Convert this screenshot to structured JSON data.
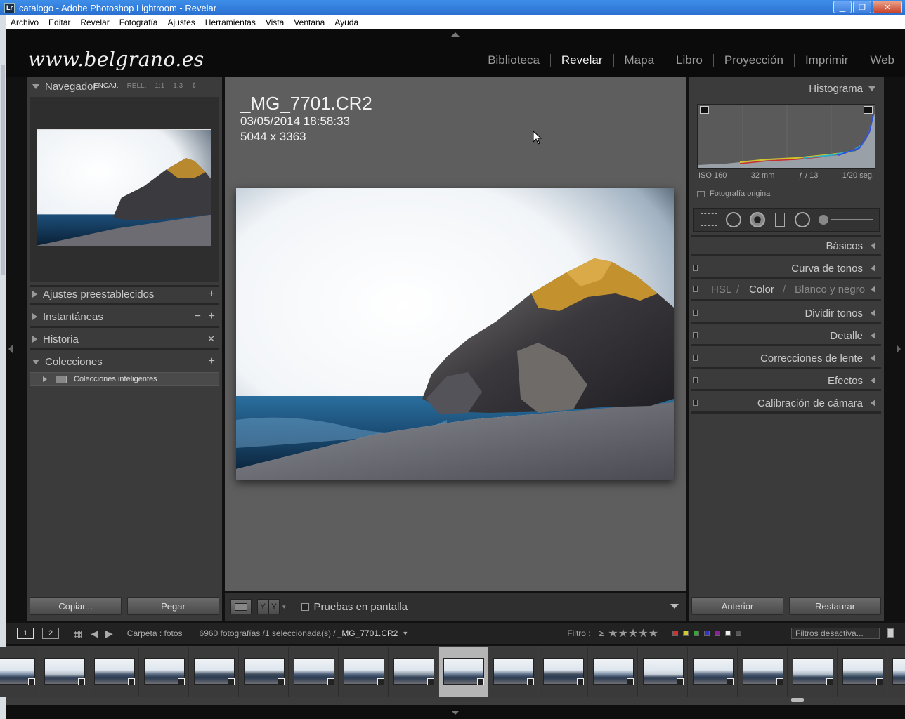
{
  "window": {
    "title": "catalogo - Adobe Photoshop Lightroom - Revelar",
    "app_icon_text": "Lr"
  },
  "menu": [
    "Archivo",
    "Editar",
    "Revelar",
    "Fotografía",
    "Ajustes",
    "Herramientas",
    "Vista",
    "Ventana",
    "Ayuda"
  ],
  "identity_plate": "www.belgrano.es",
  "modules": [
    {
      "label": "Biblioteca",
      "active": false
    },
    {
      "label": "Revelar",
      "active": true
    },
    {
      "label": "Mapa",
      "active": false
    },
    {
      "label": "Libro",
      "active": false
    },
    {
      "label": "Proyección",
      "active": false
    },
    {
      "label": "Imprimir",
      "active": false
    },
    {
      "label": "Web",
      "active": false
    }
  ],
  "left_panel": {
    "navigator": {
      "title": "Navegador",
      "zoom": [
        "ENCAJ.",
        "RELL.",
        "1:1",
        "1:3"
      ],
      "zoom_selected": "ENCAJ."
    },
    "presets": "Ajustes preestablecidos",
    "snapshots": "Instantáneas",
    "history": "Historia",
    "collections": "Colecciones",
    "collection_item": "Colecciones inteligentes",
    "copy_button": "Copiar...",
    "paste_button": "Pegar"
  },
  "photo": {
    "filename": "_MG_7701.CR2",
    "datetime": "03/05/2014 18:58:33",
    "dimensions": "5044 x 3363"
  },
  "toolbar": {
    "softproof_label": "Pruebas en pantalla",
    "before_after": "Y|Y"
  },
  "right_panel": {
    "histogram_title": "Histograma",
    "meta": {
      "iso": "ISO 160",
      "focal": "32 mm",
      "aperture": "ƒ / 13",
      "shutter": "1/20 seg."
    },
    "original_label": "Fotografía original",
    "sections": [
      "Básicos",
      "Curva de tonos",
      "Dividir tonos",
      "Detalle",
      "Correcciones de lente",
      "Efectos",
      "Calibración de cámara"
    ],
    "hsl": {
      "hsl": "HSL",
      "color": "Color",
      "bw": "Blanco y negro"
    },
    "previous_button": "Anterior",
    "reset_button": "Restaurar"
  },
  "filmstrip_bar": {
    "view1": "1",
    "view2": "2",
    "source": "Carpeta : fotos",
    "count": "6960 fotografías /1 seleccionada(s) /",
    "current": "_MG_7701.CR2",
    "filter_label": "Filtro :",
    "filter_gte": "≥",
    "stars": "★★★★★",
    "filter_select": "Filtros desactiva..."
  },
  "colors": {
    "accent": "#3d8ee8",
    "panel": "#3b3b3b",
    "center": "#5e5e5e"
  }
}
